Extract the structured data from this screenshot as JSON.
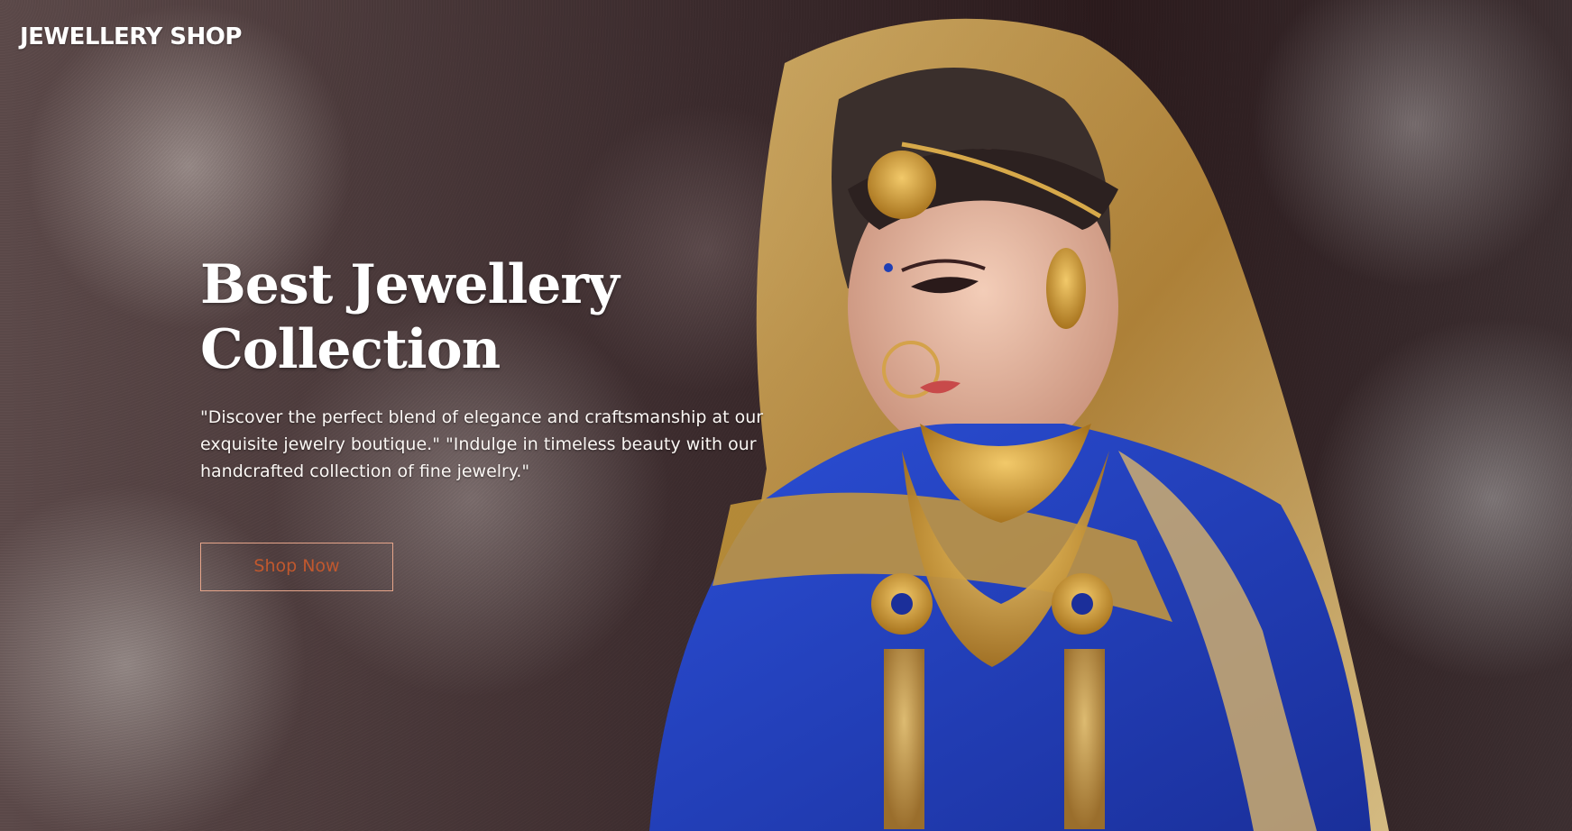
{
  "header": {
    "brand": "JEWELLERY SHOP"
  },
  "hero": {
    "title_line1": "Best Jewellery",
    "title_line2": "Collection",
    "description": "\"Discover the perfect blend of elegance and craftsmanship at our exquisite jewelry boutique.\" \"Indulge in timeless beauty with our handcrafted collection of fine jewelry.\"",
    "cta_label": "Shop Now"
  },
  "colors": {
    "cta_text": "#c0582e",
    "cta_border": "#e6a58a",
    "saree_blue": "#1f3fb5",
    "gold": "#c99a3a"
  }
}
